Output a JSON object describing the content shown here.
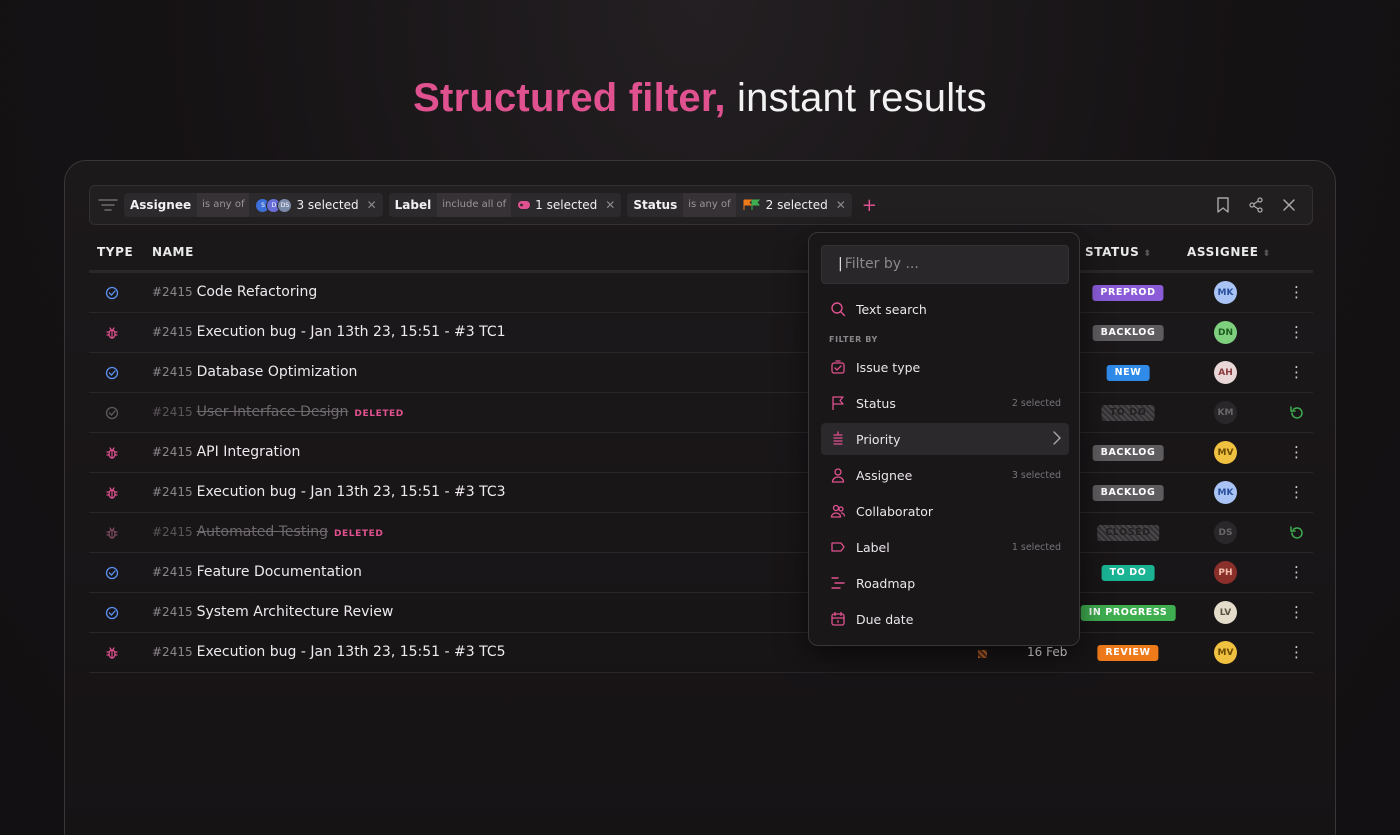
{
  "headline": {
    "accent": "Structured filter,",
    "rest": " instant results"
  },
  "filters": [
    {
      "field": "Assignee",
      "op": "is any of",
      "value": "3 selected"
    },
    {
      "field": "Label",
      "op": "include all of",
      "value": "1 selected"
    },
    {
      "field": "Status",
      "op": "is any of",
      "value": "2 selected"
    }
  ],
  "columns": {
    "type": "TYPE",
    "name": "NAME",
    "status": "STATUS",
    "assignee": "ASSIGNEE"
  },
  "rows": [
    {
      "kind": "task",
      "num": "#2415",
      "title": "Code Refactoring",
      "deleted": false,
      "status": "PREPROD",
      "status_color": "#8a5cd8",
      "assignee": "MK",
      "av_bg": "#a9c3f5",
      "av_fg": "#2a4f9b"
    },
    {
      "kind": "bug",
      "num": "#2415",
      "title": "Execution bug - Jan 13th 23, 15:51 - #3 TC1",
      "deleted": false,
      "status": "BACKLOG",
      "status_color": "#5f5c60",
      "assignee": "DN",
      "av_bg": "#7ed07e",
      "av_fg": "#1f5a1f"
    },
    {
      "kind": "task",
      "num": "#2415",
      "title": "Database Optimization",
      "deleted": false,
      "status": "NEW",
      "status_color": "#2f8ae8",
      "assignee": "AH",
      "av_bg": "#e9d7d7",
      "av_fg": "#8a3a3a"
    },
    {
      "kind": "task",
      "num": "#2415",
      "title": "User Interface Design",
      "deleted": true,
      "deleted_label": "DELETED",
      "status": "TO DO",
      "status_color": "ghost",
      "assignee": "KM",
      "av_bg": "#2a272a",
      "av_fg": "#6a666a"
    },
    {
      "kind": "bug",
      "num": "#2415",
      "title": "API Integration",
      "deleted": false,
      "status": "BACKLOG",
      "status_color": "#5f5c60",
      "assignee": "MV",
      "av_bg": "#f0c040",
      "av_fg": "#6a4a00"
    },
    {
      "kind": "bug",
      "num": "#2415",
      "title": "Execution bug - Jan 13th 23, 15:51 - #3 TC3",
      "deleted": false,
      "status": "BACKLOG",
      "status_color": "#5f5c60",
      "assignee": "MK",
      "av_bg": "#a9c3f5",
      "av_fg": "#2a4f9b"
    },
    {
      "kind": "bug",
      "num": "#2415",
      "title": "Automated Testing",
      "deleted": true,
      "deleted_label": "DELETED",
      "status": "CLOSED",
      "status_color": "ghost",
      "assignee": "DS",
      "av_bg": "#2a272a",
      "av_fg": "#6a666a"
    },
    {
      "kind": "task",
      "num": "#2415",
      "title": "Feature Documentation",
      "deleted": false,
      "status": "TO DO",
      "status_color": "#1ab394",
      "assignee": "PH",
      "av_bg": "#8b2f2a",
      "av_fg": "#f3c0b0"
    },
    {
      "kind": "task",
      "num": "#2415",
      "title": "System Architecture Review",
      "deleted": false,
      "status": "IN PROGRESS",
      "status_color": "#3fae50",
      "assignee": "LV",
      "av_bg": "#e3dccb",
      "av_fg": "#5a5040"
    },
    {
      "kind": "bug",
      "num": "#2415",
      "title": "Execution bug - Jan 13th 23, 15:51 - #3 TC5",
      "deleted": false,
      "status": "REVIEW",
      "status_color": "#ef7a1a",
      "assignee": "MV",
      "av_bg": "#f0c040",
      "av_fg": "#6a4a00",
      "date": "16 Feb"
    }
  ],
  "dropdown": {
    "placeholder": "Filter by ...",
    "text_search": "Text search",
    "section": "FILTER BY",
    "items": [
      {
        "label": "Issue type",
        "meta": "",
        "icon": "issue-type-icon"
      },
      {
        "label": "Status",
        "meta": "2 selected",
        "icon": "flag-icon"
      },
      {
        "label": "Priority",
        "meta": "",
        "icon": "priority-icon"
      },
      {
        "label": "Assignee",
        "meta": "3 selected",
        "icon": "user-icon"
      },
      {
        "label": "Collaborator",
        "meta": "",
        "icon": "users-icon"
      },
      {
        "label": "Label",
        "meta": "1 selected",
        "icon": "tag-icon"
      },
      {
        "label": "Roadmap",
        "meta": "",
        "icon": "roadmap-icon"
      },
      {
        "label": "Due date",
        "meta": "",
        "icon": "calendar-icon"
      }
    ]
  },
  "colors": {
    "accent": "#e0528f",
    "task_icon": "#5b8ff0",
    "bug_icon": "#e0528f"
  }
}
